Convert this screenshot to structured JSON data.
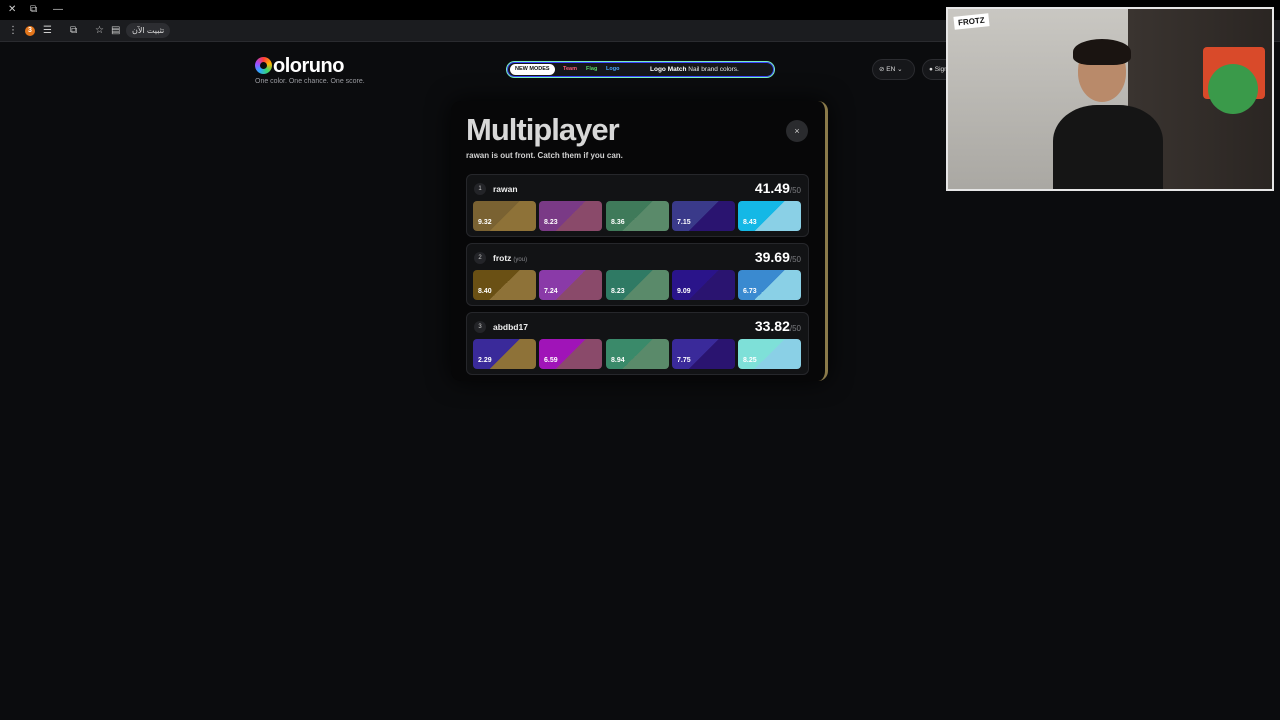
{
  "browser": {
    "install_label": "تثبيت الآن",
    "extension_badge": "3"
  },
  "header": {
    "logo_text": "oloruno",
    "tagline": "One color. One chance. One score.",
    "new_modes_label": "NEW MODES",
    "modes": [
      {
        "label": "Team",
        "color": "#ff5d7a"
      },
      {
        "label": "Flag",
        "color": "#5bd46b"
      },
      {
        "label": "Logo",
        "color": "#4aa8ff"
      }
    ],
    "promo_title": "Logo Match",
    "promo_text": "Nail brand colors.",
    "lang_label": "EN",
    "sign_label": "Sign"
  },
  "modal": {
    "title": "Multiplayer",
    "subtitle": "rawan is out front. Catch them if you can.",
    "close_label": "×",
    "players": [
      {
        "rank": "1",
        "name": "rawan",
        "you": "",
        "score": "41.49",
        "max": "/50",
        "rounds": [
          {
            "value": "9.32",
            "target": "#7a6232",
            "guess": "#8e7238"
          },
          {
            "value": "8.23",
            "target": "#7a3a86",
            "guess": "#8a4a6a"
          },
          {
            "value": "8.36",
            "target": "#3f7a5a",
            "guess": "#5a8a6a"
          },
          {
            "value": "7.15",
            "target": "#3a3a8a",
            "guess": "#2a1470"
          },
          {
            "value": "8.43",
            "target": "#14b8e6",
            "guess": "#8ad0e6"
          }
        ]
      },
      {
        "rank": "2",
        "name": "frotz",
        "you": "(you)",
        "score": "39.69",
        "max": "/50",
        "rounds": [
          {
            "value": "8.40",
            "target": "#6a5014",
            "guess": "#8e7238"
          },
          {
            "value": "7.24",
            "target": "#8a3aa8",
            "guess": "#8a4a6a"
          },
          {
            "value": "8.23",
            "target": "#2f7a64",
            "guess": "#5a8a6a"
          },
          {
            "value": "9.09",
            "target": "#2a148a",
            "guess": "#2a1470"
          },
          {
            "value": "6.73",
            "target": "#3a8ad0",
            "guess": "#8ad0e6"
          }
        ]
      },
      {
        "rank": "3",
        "name": "abdbd17",
        "you": "",
        "score": "33.82",
        "max": "/50",
        "rounds": [
          {
            "value": "2.29",
            "target": "#3a2a9a",
            "guess": "#8e7238"
          },
          {
            "value": "6.59",
            "target": "#a014b8",
            "guess": "#8a4a6a"
          },
          {
            "value": "8.94",
            "target": "#3a8a6a",
            "guess": "#5a8a6a"
          },
          {
            "value": "7.75",
            "target": "#3a2a9a",
            "guess": "#2a1470"
          },
          {
            "value": "8.25",
            "target": "#7ee0d8",
            "guess": "#8ad0e6"
          }
        ]
      }
    ]
  },
  "webcam": {
    "tag": "FROTZ"
  }
}
